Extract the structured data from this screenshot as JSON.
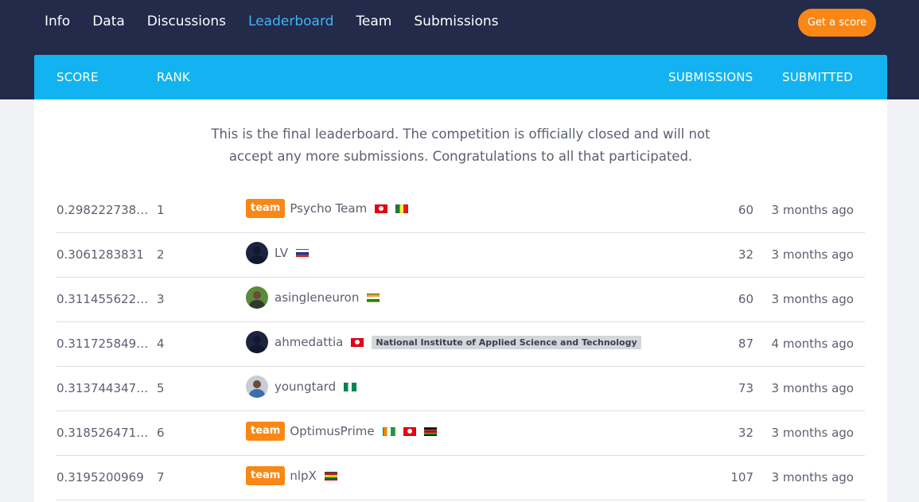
{
  "nav": {
    "items": [
      "Info",
      "Data",
      "Discussions",
      "Leaderboard",
      "Team",
      "Submissions"
    ],
    "active": "Leaderboard",
    "cta_label": "Get a score"
  },
  "table": {
    "headers": {
      "score": "SCORE",
      "rank": "RANK",
      "submissions": "SUBMISSIONS",
      "submitted": "SUBMITTED"
    },
    "notice_line1": "This is the final leaderboard. The competition is officially closed and will not",
    "notice_line2": "accept any more submissions. Congratulations to all that participated.",
    "team_badge": "team",
    "rows": [
      {
        "score": "0.298222738…",
        "rank": "1",
        "name": "Psycho Team",
        "submissions": "60",
        "submitted": "3 months ago"
      },
      {
        "score": "0.3061283831",
        "rank": "2",
        "name": "LV",
        "submissions": "32",
        "submitted": "3 months ago"
      },
      {
        "score": "0.311455622…",
        "rank": "3",
        "name": "asingleneuron",
        "submissions": "60",
        "submitted": "3 months ago"
      },
      {
        "score": "0.311725849…",
        "rank": "4",
        "name": "ahmedattia",
        "institution": "National Institute of Applied Science and Technology",
        "submissions": "87",
        "submitted": "4 months ago"
      },
      {
        "score": "0.313744347…",
        "rank": "5",
        "name": "youngtard",
        "submissions": "73",
        "submitted": "3 months ago"
      },
      {
        "score": "0.318526471…",
        "rank": "6",
        "name": "OptimusPrime",
        "submissions": "32",
        "submitted": "3 months ago"
      },
      {
        "score": "0.3195200969",
        "rank": "7",
        "name": "nlpX",
        "submissions": "107",
        "submitted": "3 months ago"
      }
    ]
  },
  "colors": {
    "navbar": "#232a4a",
    "header": "#12b3f0",
    "accent_orange": "#f98716",
    "active_tab": "#3fb6f5"
  }
}
